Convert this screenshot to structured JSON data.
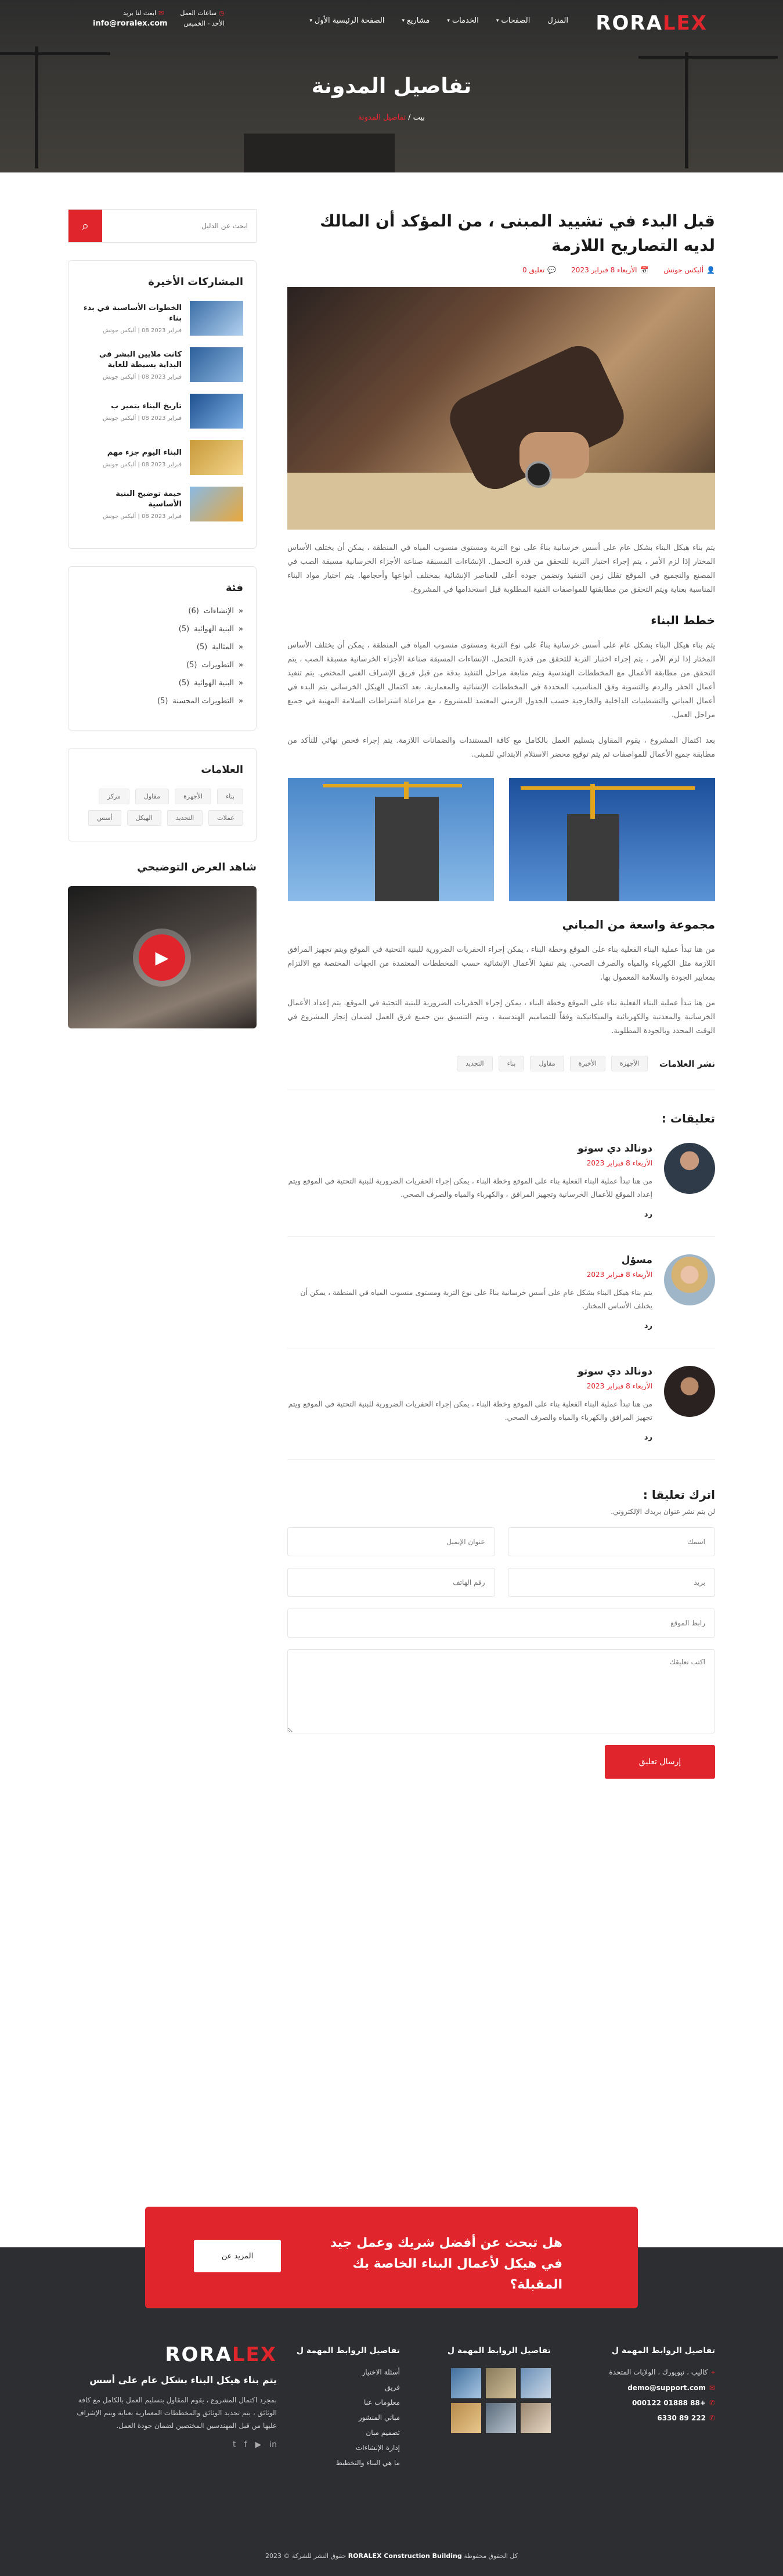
{
  "brand": {
    "logo_main": "RORA",
    "logo_accent": "LEX",
    "accent_color": "#e0262c"
  },
  "topbar": {
    "hours_label": "ساعات العمل",
    "hours_value": "الأحد - الخميس",
    "email_label": "ابعث لنا بريد",
    "email_value": "info@roralex.com"
  },
  "nav": {
    "items": [
      {
        "label": "المنزل"
      },
      {
        "label": "الصفحات"
      },
      {
        "label": "الخدمات"
      },
      {
        "label": "مشاريع"
      },
      {
        "label": "خدمات"
      },
      {
        "label": "الصفحة الرئيسية الأول"
      }
    ]
  },
  "hero": {
    "title": "تفاصيل المدونة",
    "crumb_home": "بيت",
    "crumb_sep": " / ",
    "crumb_current": "تفاصيل المدونة"
  },
  "post": {
    "title": "قبل البدء في تشييد المبنى ، من المؤكد أن المالك لديه التصاريح اللازمة",
    "author": "أليكس جونش",
    "date": "الأربعاء 8 فبراير 2023",
    "comments": "تعليق 0",
    "para1": "يتم بناء هيكل البناء بشكل عام على أسس خرسانية بناءً على نوع التربة ومستوى منسوب المياه في المنطقة ، يمكن أن يختلف الأساس المختار إذا لزم الأمر ، يتم إجراء اختبار التربة للتحقق من قدرة التحمل. الإنشاءات المسبقة صناعة الأجزاء الخرسانية مسبقة الصب في المصنع والتجميع في الموقع تقلل زمن التنفيذ وتضمن جودة أعلى للعناصر الإنشائية بمختلف أنواعها وأحجامها. يتم اختيار مواد البناء المناسبة بعناية ويتم التحقق من مطابقتها للمواصفات الفنية المطلوبة قبل استخدامها في المشروع.",
    "h2": "خطط البناء",
    "para2": "يتم بناء هيكل البناء بشكل عام على أسس خرسانية بناءً على نوع التربة ومستوى منسوب المياه في المنطقة ، يمكن أن يختلف الأساس المختار إذا لزم الأمر ، يتم إجراء اختبار التربة للتحقق من قدرة التحمل. الإنشاءات المسبقة صناعة الأجزاء الخرسانية مسبقة الصب ، يتم التحقق من مطابقة الأعمال مع المخططات الهندسية ويتم متابعة مراحل التنفيذ بدقة من قبل فريق الإشراف الفني المختص. يتم تنفيذ أعمال الحفر والردم والتسوية وفق المناسيب المحددة في المخططات الإنشائية والمعمارية. بعد اكتمال الهيكل الخرساني يتم البدء في أعمال المباني والتشطيبات الداخلية والخارجية حسب الجدول الزمني المعتمد للمشروع ، مع مراعاة اشتراطات السلامة المهنية في جميع مراحل العمل.",
    "para3": "بعد اكتمال المشروع ، يقوم المقاول بتسليم العمل بالكامل مع كافة المستندات والضمانات اللازمة. يتم إجراء فحص نهائي للتأكد من مطابقة جميع الأعمال للمواصفات ثم يتم توقيع محضر الاستلام الابتدائي للمبنى.",
    "h3": "مجموعة واسعة من المباني",
    "para4": "من هنا تبدأ عملية البناء الفعلية بناء على الموقع وخطة البناء ، يمكن إجراء الحفريات الضرورية للبنية التحتية في الموقع ويتم تجهيز المرافق اللازمة مثل الكهرباء والمياه والصرف الصحي. يتم تنفيذ الأعمال الإنشائية حسب المخططات المعتمدة من الجهات المختصة مع الالتزام بمعايير الجودة والسلامة المعمول بها.",
    "para5": "من هنا تبدأ عملية البناء الفعلية بناء على الموقع وخطة البناء ، يمكن إجراء الحفريات الضرورية للبنية التحتية في الموقع. يتم إعداد الأعمال الخرسانية والمعدنية والكهربائية والميكانيكية وفقاً للتصاميم الهندسية ، ويتم التنسيق بين جميع فرق العمل لضمان إنجاز المشروع في الوقت المحدد وبالجودة المطلوبة."
  },
  "tags_line": {
    "label": "نشر العلامات",
    "tags": [
      "الأجهزة",
      "الأخيرة",
      "مقاول",
      "بناء",
      "التجديد"
    ]
  },
  "comments": {
    "heading": "تعليقات :",
    "items": [
      {
        "name": "دونالد دي سوتو",
        "date": "الأربعاء 8 فبراير 2023",
        "text": "من هنا تبدأ عملية البناء الفعلية بناء على الموقع وخطة البناء ، يمكن إجراء الحفريات الضرورية للبنية التحتية في الموقع ويتم إعداد الموقع للأعمال الخرسانية وتجهيز المرافق ، والكهرباء والمياه والصرف الصحي.",
        "reply": "رد"
      },
      {
        "name": "مسؤل",
        "date": "الأربعاء 8 فبراير 2023",
        "text": "يتم بناء هيكل البناء بشكل عام على أسس خرسانية بناءً على نوع التربة ومستوى منسوب المياه في المنطقة ، يمكن أن يختلف الأساس المختار.",
        "reply": "رد"
      },
      {
        "name": "دونالد دي سوتو",
        "date": "الأربعاء 8 فبراير 2023",
        "text": "من هنا تبدأ عملية البناء الفعلية بناء على الموقع وخطة البناء ، يمكن إجراء الحفريات الضرورية للبنية التحتية في الموقع ويتم تجهيز المرافق والكهرباء والمياه والصرف الصحي.",
        "reply": "رد"
      }
    ]
  },
  "form": {
    "heading": "اترك تعليقا :",
    "sub": "لن يتم نشر عنوان بريدك الإلكتروني.",
    "name_ph": "اسمك",
    "email_ph": "عنوان الإيميل",
    "subject_ph": "بريد",
    "phone_ph": "رقم الهاتف",
    "website_ph": "رابط الموقع",
    "message_ph": "اكتب تعليقك",
    "submit": "إرسال تعليق"
  },
  "sidebar": {
    "search_ph": "ابحث عن الدليل",
    "recent_title": "المشاركات الأخيرة",
    "recent": [
      {
        "title": "الخطوات الأساسية في بدء بناء",
        "date": "فبراير 2023 08 | أليكس جونش"
      },
      {
        "title": "كانت ملايين البشر في البداية بسيطة للغاية",
        "date": "فبراير 2023 08 | أليكس جونش"
      },
      {
        "title": "تاريخ البناء يتميز ب",
        "date": "فبراير 2023 08 | أليكس جونش"
      },
      {
        "title": "البناء اليوم جزء مهم",
        "date": "فبراير 2023 08 | أليكس جونش"
      },
      {
        "title": "خيمة توضيح البنية الأساسية",
        "date": "فبراير 2023 08 | أليكس جونش"
      }
    ],
    "cat_title": "فئة",
    "cats": [
      {
        "label": "الإنشاءات",
        "count": "(6)"
      },
      {
        "label": "البنية الهوائية",
        "count": "(5)"
      },
      {
        "label": "المثالية",
        "count": "(5)"
      },
      {
        "label": "التطويرات",
        "count": "(5)"
      },
      {
        "label": "البنية الهوائية",
        "count": "(5)"
      },
      {
        "label": "التطويرات المحسنة",
        "count": "(5)"
      }
    ],
    "tags_title": "العلامات",
    "tags": [
      "بناء",
      "الأجهزة",
      "مقاول",
      "مركز",
      "عملات",
      "التجديد",
      "الهيكل",
      "أسس"
    ],
    "video_title": "شاهد العرض التوضيحي"
  },
  "cta": {
    "text": "هل تبحث عن أفضل شريك وعمل جيد في هيكل لأعمال البناء الخاصة بك المقبلة؟",
    "button": "المزيد عن"
  },
  "footer": {
    "contact_title": "تفاصيل الروابط المهمة ل",
    "address": "كاليب ، نيويورك ، الولايات المتحدة",
    "email": "demo@support.com",
    "phone1": "+88 01888 000122",
    "phone2": "222 89 6330",
    "gallery_title": "تفاصيل الروابط المهمة ل",
    "links_title": "تفاصيل الروابط المهمة ل",
    "links": [
      "أسئلة الاختيار",
      "فريق",
      "معلومات عنا",
      "مباني المنشور",
      "تصميم مبان",
      "إدارة الإنشاءات",
      "ما هي البناء والتخطيط"
    ],
    "about_title": "يتم بناء هيكل البناء بشكل عام على أسس",
    "about_text": "بمجرد اكتمال المشروع ، يقوم المقاول بتسليم العمل بالكامل مع كافة الوثائق ، يتم تحديد الوثائق والمخططات المعمارية بعناية ويتم الإشراف عليها من قبل المهندسين المختصين لضمان جودة العمل.",
    "copyright_pre": "كل الحقوق محفوظة",
    "copyright_brand": "RORALEX Construction Building",
    "copyright_post": "حقوق النشر للشركة © 2023"
  }
}
